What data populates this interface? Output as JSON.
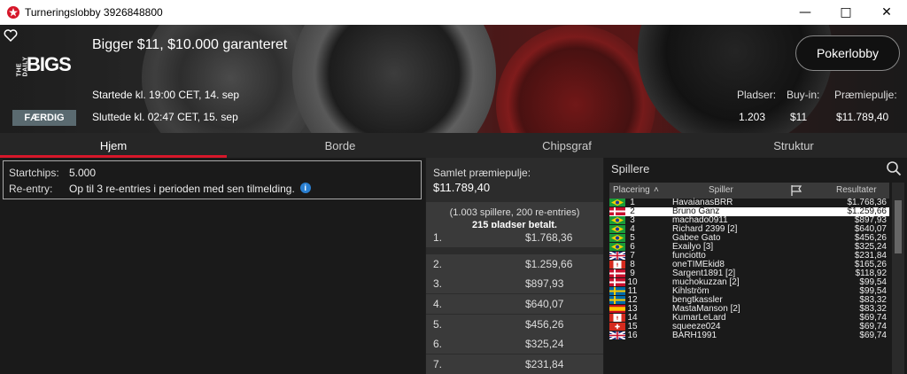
{
  "window": {
    "title": "Turneringslobby 3926848800"
  },
  "banner": {
    "logo_small": "THE DAILY",
    "logo_big": "BIGS",
    "status": "FÆRDIG",
    "tournament_name": "Bigger $11, $10.000 garanteret",
    "started": "Startede kl. 19:00 CET, 14. sep",
    "ended": "Sluttede kl. 02:47 CET, 15. sep",
    "pokerlobby_label": "Pokerlobby",
    "stats": [
      {
        "label": "Pladser:",
        "value": "1.203"
      },
      {
        "label": "Buy-in:",
        "value": "$11"
      },
      {
        "label": "Præmiepulje:",
        "value": "$11.789,40"
      }
    ]
  },
  "tabs": [
    "Hjem",
    "Borde",
    "Chipsgraf",
    "Struktur"
  ],
  "info": {
    "startchips_label": "Startchips:",
    "startchips_value": "5.000",
    "reentry_label": "Re-entry:",
    "reentry_value": "Op til 3 re-entries i perioden med sen tilmelding.",
    "info_icon": "i"
  },
  "prize": {
    "heading": "Samlet præmiepulje:",
    "total": "$11.789,40",
    "sub_line1": "(1.003 spillere, 200 re-entries)",
    "sub_line2": "215 pladser betalt.",
    "rows": [
      {
        "pos": "1.",
        "amount": "$1.768,36"
      },
      {
        "pos": "2.",
        "amount": "$1.259,66"
      },
      {
        "pos": "3.",
        "amount": "$897,93"
      },
      {
        "pos": "4.",
        "amount": "$640,07"
      },
      {
        "pos": "5.",
        "amount": "$456,26"
      },
      {
        "pos": "6.",
        "amount": "$325,24"
      },
      {
        "pos": "7.",
        "amount": "$231,84"
      }
    ]
  },
  "players": {
    "title": "Spillere",
    "columns": {
      "rank": "Placering",
      "player": "Spiller",
      "results": "Resultater"
    },
    "rows": [
      {
        "rank": "1",
        "name": "HavaianasBRR",
        "flag": "brazil-flag",
        "result": "$1.768,36"
      },
      {
        "rank": "2",
        "name": "Bruno Ganz",
        "flag": "denmark-flag",
        "result": "$1.259,66"
      },
      {
        "rank": "3",
        "name": "machado0911",
        "flag": "brazil-flag",
        "result": "$897,93"
      },
      {
        "rank": "4",
        "name": "Richard 2399 [2]",
        "flag": "brazil-flag",
        "result": "$640,07"
      },
      {
        "rank": "5",
        "name": "Gabee Gato",
        "flag": "brazil-flag",
        "result": "$456,26"
      },
      {
        "rank": "6",
        "name": "Exailyo [3]",
        "flag": "brazil-flag",
        "result": "$325,24"
      },
      {
        "rank": "7",
        "name": "funciotto",
        "flag": "uk-flag",
        "result": "$231,84"
      },
      {
        "rank": "8",
        "name": "oneTIMEkid8",
        "flag": "canada-flag",
        "result": "$165,26"
      },
      {
        "rank": "9",
        "name": "Sargent1891 [2]",
        "flag": "denmark-flag",
        "result": "$118,92"
      },
      {
        "rank": "10",
        "name": "muchokuzzan [2]",
        "flag": "denmark-flag",
        "result": "$99,54"
      },
      {
        "rank": "11",
        "name": "Kihlström",
        "flag": "sweden-flag",
        "result": "$99,54"
      },
      {
        "rank": "12",
        "name": "bengtkassler",
        "flag": "sweden-flag",
        "result": "$83,32"
      },
      {
        "rank": "13",
        "name": "MastaManson [2]",
        "flag": "spain-flag",
        "result": "$83,32"
      },
      {
        "rank": "14",
        "name": "KumarLeLard",
        "flag": "canada-flag",
        "result": "$69,74"
      },
      {
        "rank": "15",
        "name": "squeeze024",
        "flag": "switzerland-flag",
        "result": "$69,74"
      },
      {
        "rank": "16",
        "name": "BARH1991",
        "flag": "uk-flag",
        "result": "$69,74"
      }
    ]
  }
}
